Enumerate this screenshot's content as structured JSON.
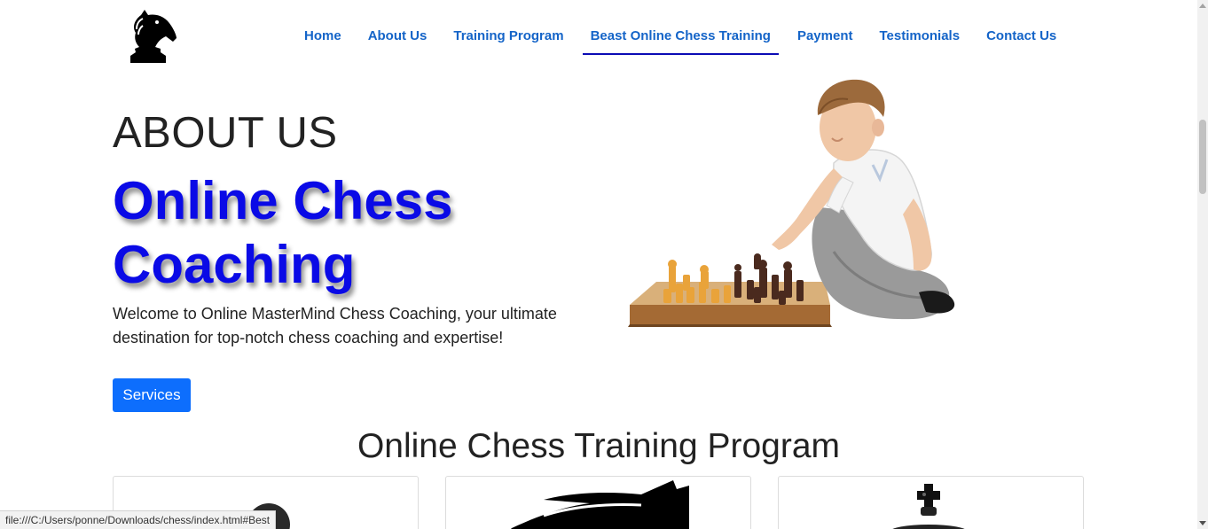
{
  "logo": {
    "icon": "knight-icon"
  },
  "nav": {
    "items": [
      {
        "label": "Home",
        "active": false
      },
      {
        "label": "About Us",
        "active": false
      },
      {
        "label": "Training Program",
        "active": false
      },
      {
        "label": "Beast Online Chess Training",
        "active": true
      },
      {
        "label": "Payment",
        "active": false
      },
      {
        "label": "Testimonials",
        "active": false
      },
      {
        "label": "Contact Us",
        "active": false
      }
    ]
  },
  "hero": {
    "kicker": "ABOUT US",
    "title": "Online Chess Coaching",
    "text": "Welcome to Online MasterMind Chess Coaching, your ultimate destination for top-notch chess coaching and expertise!",
    "button_label": "Services",
    "image": "boy-playing-chess-illustration"
  },
  "training": {
    "heading": "Online Chess Training Program",
    "cards": [
      {
        "icon": "pawn-icon"
      },
      {
        "icon": "knight-head-icon"
      },
      {
        "icon": "king-icon"
      }
    ]
  },
  "status_bar": {
    "url": "file:///C:/Users/ponne/Downloads/chess/index.html#Best"
  },
  "colors": {
    "nav_link": "#1464c8",
    "active_underline": "#0b0bb5",
    "hero_title": "#0a0ae6",
    "button": "#0d6efd"
  }
}
